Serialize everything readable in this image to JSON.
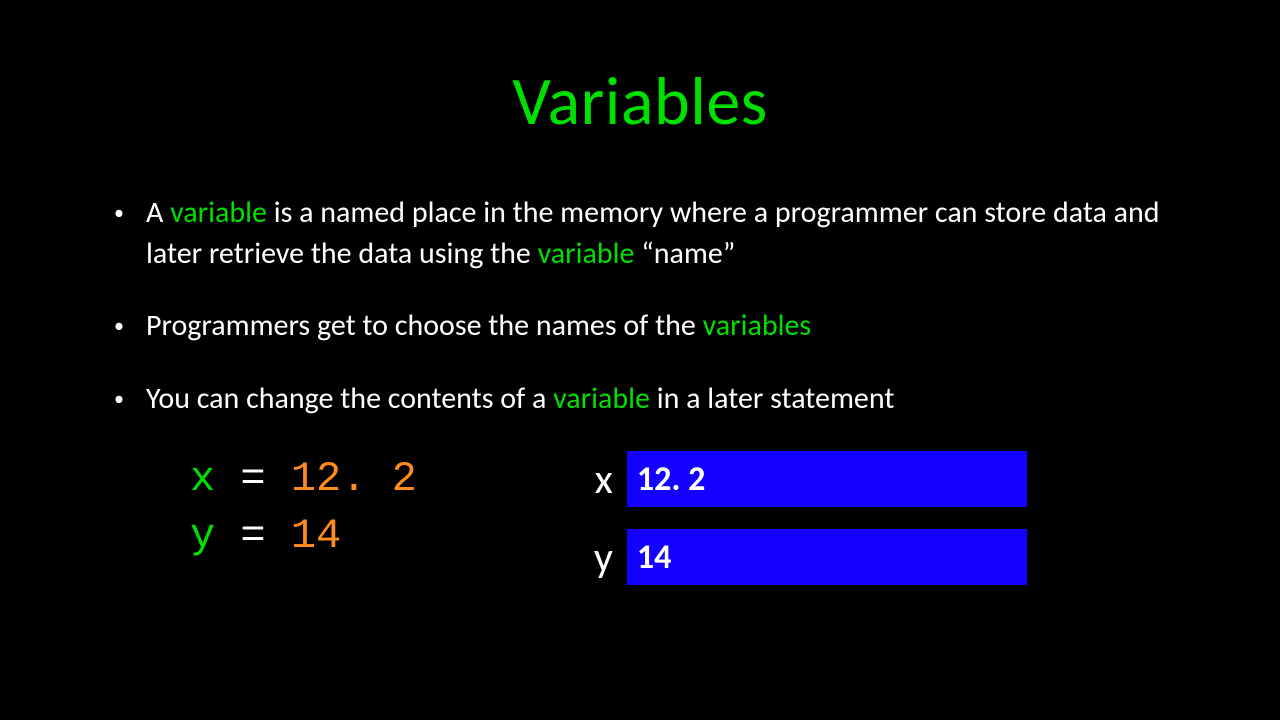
{
  "title": "Variables",
  "bullets": {
    "b1": {
      "t1": "A ",
      "kw1": "variable",
      "t2": " is a named place in the memory where a programmer can store data and later retrieve the data using the ",
      "kw2": "variable",
      "t3": " “name”"
    },
    "b2": {
      "t1": "Programmers get to choose the names of the ",
      "kw1": "variables"
    },
    "b3": {
      "t1": "You can change the contents of a ",
      "kw1": "variable",
      "t2": " in a later statement"
    }
  },
  "code": {
    "line1": {
      "var": "x",
      "eq": " = ",
      "val": "12. 2"
    },
    "line2": {
      "var": "y",
      "eq": " = ",
      "val": "14"
    }
  },
  "boxes": {
    "row1": {
      "label": "x",
      "value": "12. 2"
    },
    "row2": {
      "label": "y",
      "value": "14"
    }
  }
}
